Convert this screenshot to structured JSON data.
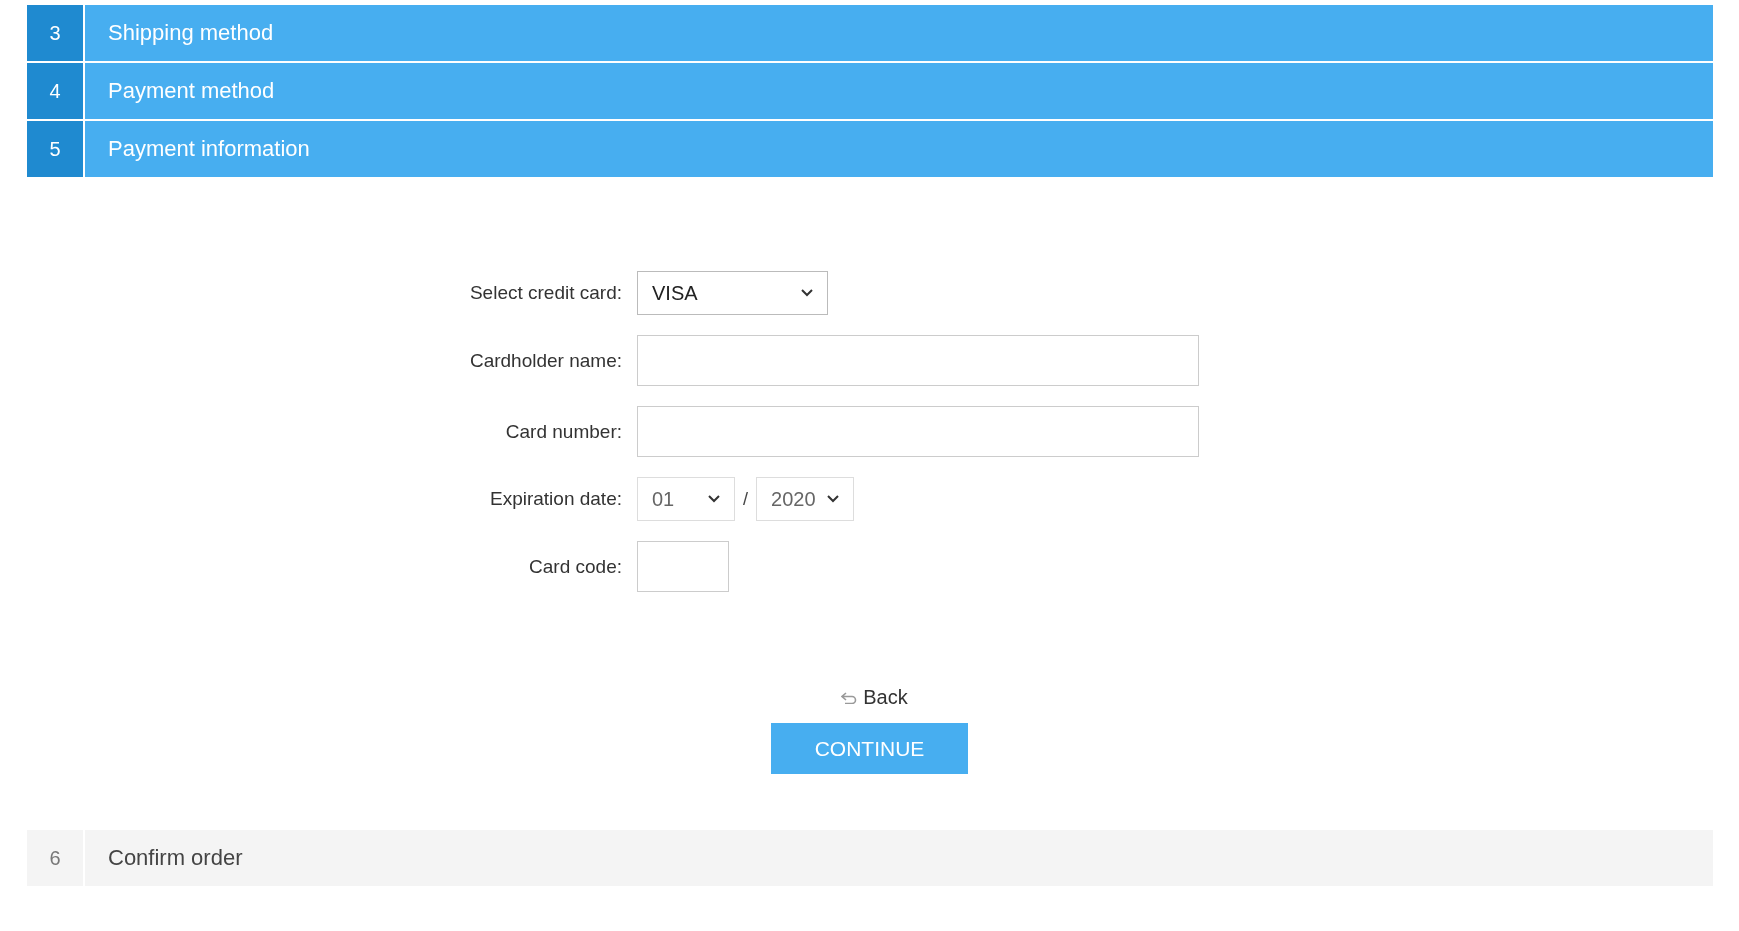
{
  "steps_top": [
    {
      "number": "3",
      "title": "Shipping method",
      "active": true
    },
    {
      "number": "4",
      "title": "Payment method",
      "active": true
    },
    {
      "number": "5",
      "title": "Payment information",
      "active": true
    }
  ],
  "form": {
    "card_type": {
      "label": "Select credit card:",
      "value": "VISA"
    },
    "cardholder_name": {
      "label": "Cardholder name:"
    },
    "card_number": {
      "label": "Card number:"
    },
    "expiration": {
      "label": "Expiration date:",
      "month": "01",
      "separator": "/",
      "year": "2020"
    },
    "card_code": {
      "label": "Card code:"
    }
  },
  "back_link": "Back",
  "continue_button": "CONTINUE",
  "steps_bottom": [
    {
      "number": "6",
      "title": "Confirm order",
      "active": false
    }
  ]
}
